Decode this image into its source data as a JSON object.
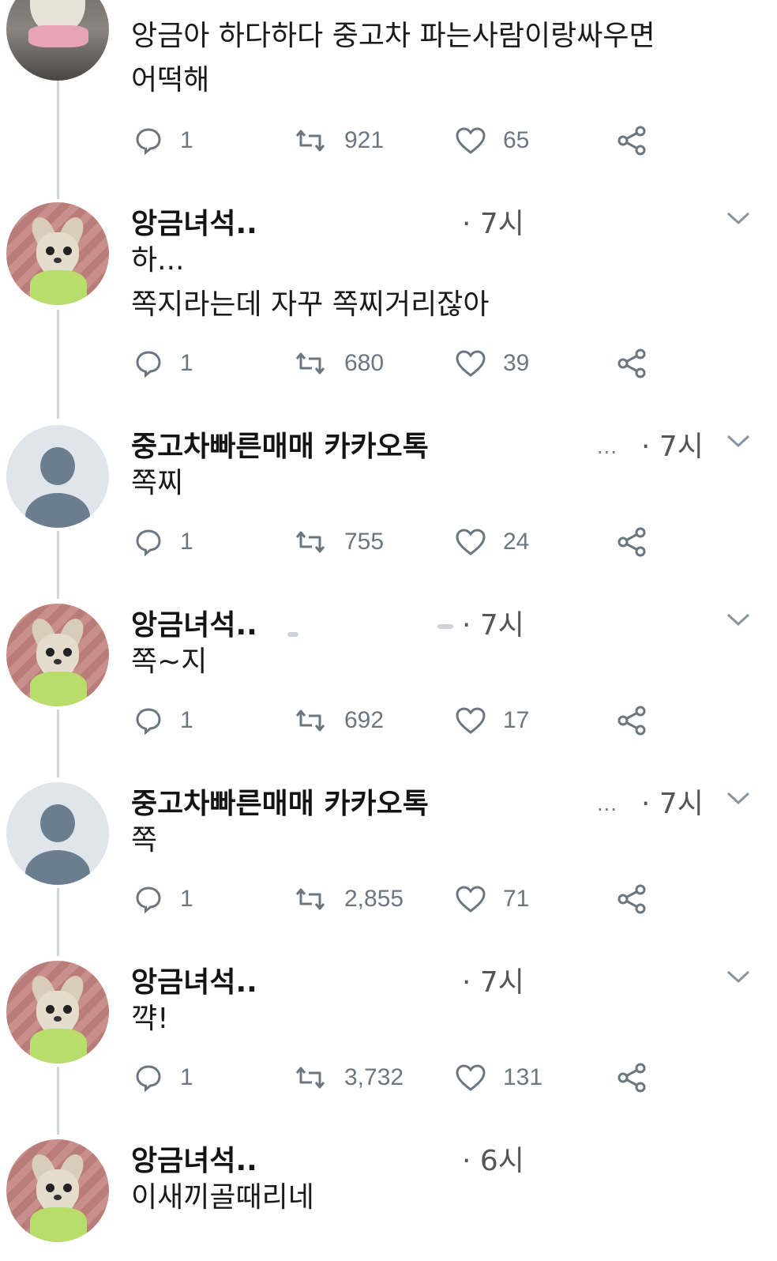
{
  "tweets": [
    {
      "name": "",
      "time": "",
      "lines": [
        "앙금아 하다하다 중고차 파는사람이랑싸우면",
        "어떡해"
      ],
      "replies": "1",
      "retweets": "921",
      "likes": "65"
    },
    {
      "name": "앙금녀석..",
      "time": "· 7시",
      "lines": [
        "하...",
        "쪽지라는데 자꾸 쪽찌거리잖아"
      ],
      "replies": "1",
      "retweets": "680",
      "likes": "39"
    },
    {
      "name": "중고차빠른매매 카카오톡",
      "time": "· 7시",
      "more": "...",
      "lines": [
        "쪽찌"
      ],
      "replies": "1",
      "retweets": "755",
      "likes": "24"
    },
    {
      "name": "앙금녀석..",
      "time": "· 7시",
      "lines": [
        "쪽~지"
      ],
      "replies": "1",
      "retweets": "692",
      "likes": "17"
    },
    {
      "name": "중고차빠른매매 카카오톡",
      "time": "· 7시",
      "more": "...",
      "lines": [
        "쪽"
      ],
      "replies": "1",
      "retweets": "2,855",
      "likes": "71"
    },
    {
      "name": "앙금녀석..",
      "time": "· 7시",
      "lines": [
        "꺅!"
      ],
      "replies": "1",
      "retweets": "3,732",
      "likes": "131"
    },
    {
      "name": "앙금녀석..",
      "time": "· 6시",
      "lines": [
        "이새끼골때리네"
      ]
    }
  ],
  "icons": {
    "reply": "reply-icon",
    "retweet": "retweet-icon",
    "like": "heart-icon",
    "share": "share-icon",
    "menu": "chevron-down-icon"
  },
  "colors": {
    "icon": "#6b7680",
    "thread_line": "#cfd6dc"
  }
}
